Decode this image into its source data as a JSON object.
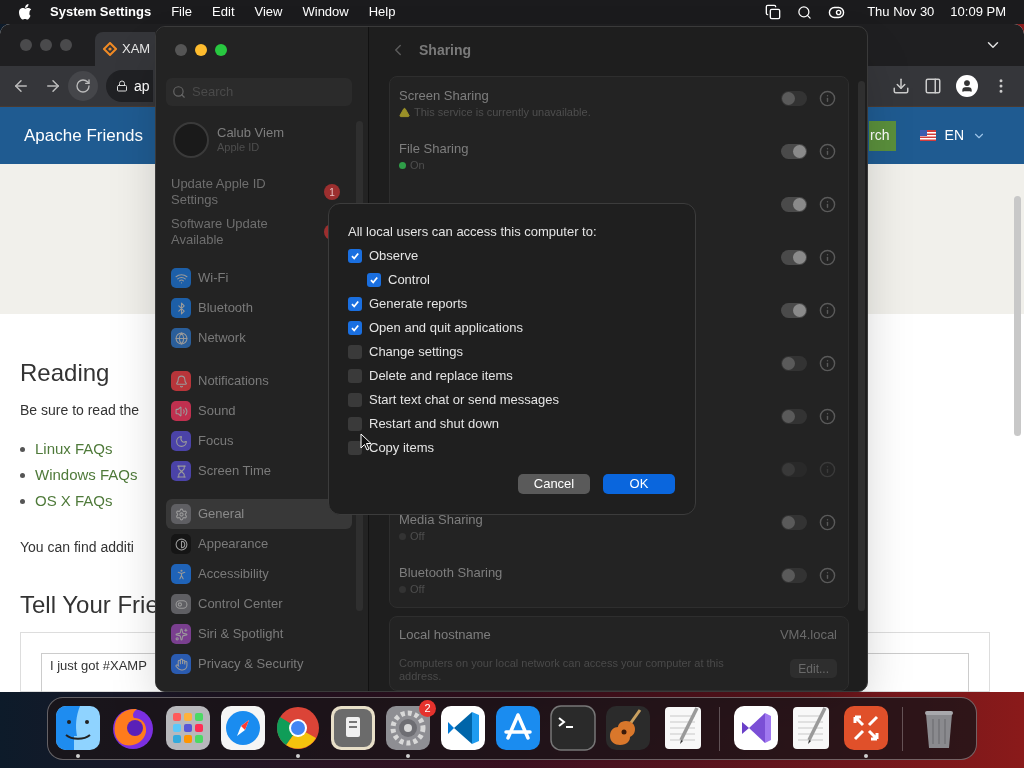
{
  "menubar": {
    "app": "System Settings",
    "menus": [
      "File",
      "Edit",
      "View",
      "Window",
      "Help"
    ],
    "date": "Thu Nov 30",
    "time": "10:09 PM"
  },
  "browser": {
    "tab_title": "XAM",
    "address": "ap",
    "brand": "Apache Friends",
    "search_button": "rch",
    "language": "EN",
    "heading": "Reading",
    "intro": "Be sure to read the",
    "links": [
      "Linux FAQs",
      "Windows FAQs",
      "OS X FAQs"
    ],
    "more": "You can find additi",
    "share_heading": "Tell Your Frie",
    "share_text": "I just got #XAMP"
  },
  "settings": {
    "search": {
      "placeholder": "Search"
    },
    "account": {
      "name": "Calub Viem",
      "subtitle": "Apple ID"
    },
    "notices": [
      {
        "label": "Update Apple ID Settings",
        "alert": true,
        "count": "1"
      },
      {
        "label": "Software Update Available",
        "alert": true
      }
    ],
    "groups": [
      {
        "items": [
          {
            "label": "Wi-Fi",
            "color": "#1d5fa8",
            "selected": false
          },
          {
            "label": "Bluetooth",
            "color": "#1d5fa8",
            "selected": false
          },
          {
            "label": "Network",
            "color": "#2a5e9a",
            "selected": false
          }
        ]
      },
      {
        "items": [
          {
            "label": "Notifications",
            "color": "#b8353a",
            "selected": false
          },
          {
            "label": "Sound",
            "color": "#c0304f",
            "selected": false
          },
          {
            "label": "Focus",
            "color": "#4b43a8",
            "selected": false
          },
          {
            "label": "Screen Time",
            "color": "#4b43a8",
            "selected": false
          }
        ]
      },
      {
        "items": [
          {
            "label": "General",
            "color": "#5f5f63",
            "selected": true
          },
          {
            "label": "Appearance",
            "color": "#151515",
            "selected": false
          },
          {
            "label": "Accessibility",
            "color": "#1f63b8",
            "selected": false
          },
          {
            "label": "Control Center",
            "color": "#5f5f63",
            "selected": false
          },
          {
            "label": "Siri & Spotlight",
            "color": "#7a3f8f",
            "selected": false
          },
          {
            "label": "Privacy & Security",
            "color": "#2a5bb0",
            "selected": false
          }
        ]
      }
    ],
    "pane": {
      "title": "Sharing",
      "services": [
        {
          "name": "Screen Sharing",
          "status": {
            "kind": "warning",
            "text": "This service is currently unavailable."
          },
          "on": false,
          "disabled": false
        },
        {
          "name": "File Sharing",
          "status": {
            "kind": "dot",
            "color": "#2f9e48",
            "text": "On"
          },
          "on": true,
          "disabled": false
        },
        {
          "on": true,
          "disabled": false
        },
        {
          "on": true,
          "disabled": false
        },
        {
          "on": true,
          "disabled": false
        },
        {
          "on": false,
          "disabled": false
        },
        {
          "on": false,
          "disabled": false
        },
        {
          "on": false,
          "disabled": true
        },
        {
          "name": "Media Sharing",
          "status": {
            "kind": "dot",
            "color": "#333333",
            "text": "Off"
          },
          "on": false,
          "disabled": false
        },
        {
          "name": "Bluetooth Sharing",
          "status": {
            "kind": "dot",
            "color": "#333333",
            "text": "Off"
          },
          "on": false,
          "disabled": false
        }
      ],
      "hostname": {
        "label": "Local hostname",
        "value": "VM4.local",
        "description": "Computers on your local network can access your computer at this address.",
        "button": "Edit..."
      }
    }
  },
  "dialog": {
    "title": "All local users can access this computer to:",
    "options": [
      {
        "label": "Observe",
        "checked": true,
        "children": [
          {
            "label": "Control",
            "checked": true
          }
        ]
      },
      {
        "label": "Generate reports",
        "checked": true
      },
      {
        "label": "Open and quit applications",
        "checked": true
      },
      {
        "label": "Change settings",
        "checked": false
      },
      {
        "label": "Delete and replace items",
        "checked": false
      },
      {
        "label": "Start text chat or send messages",
        "checked": false
      },
      {
        "label": "Restart and shut down",
        "checked": false
      },
      {
        "label": "Copy items",
        "checked": false
      }
    ],
    "buttons": [
      {
        "label": "Cancel",
        "default": false
      },
      {
        "label": "OK",
        "default": true
      }
    ]
  },
  "dock": {
    "groups": [
      [
        {
          "running": true
        },
        {
          "running": false
        },
        {
          "running": false
        },
        {
          "running": false
        },
        {
          "running": true
        },
        {
          "running": false
        },
        {
          "running": true,
          "badge": "2"
        },
        {
          "running": false
        },
        {
          "running": false
        },
        {
          "running": false
        },
        {
          "running": false
        },
        {
          "running": false
        }
      ],
      [
        {
          "running": false
        },
        {
          "running": false
        },
        {
          "running": true
        }
      ],
      [
        {
          "running": false
        }
      ]
    ]
  }
}
